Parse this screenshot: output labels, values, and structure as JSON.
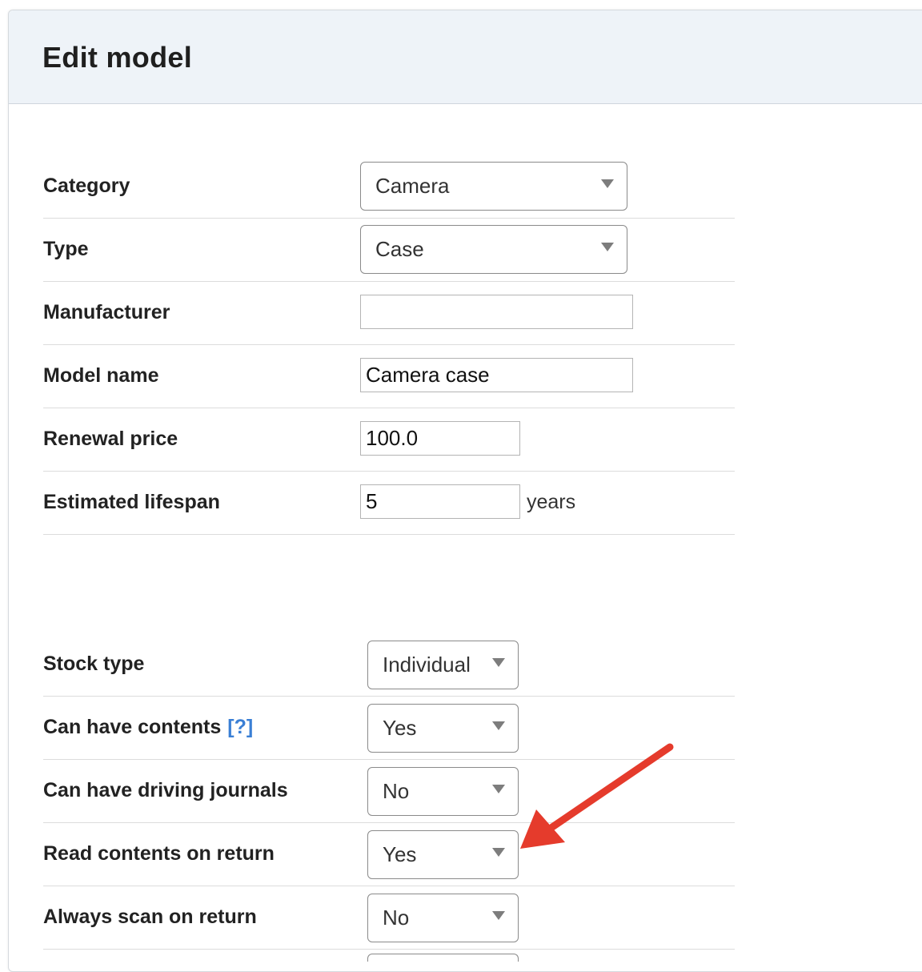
{
  "page": {
    "title": "Edit model"
  },
  "form": {
    "category": {
      "label": "Category",
      "value": "Camera"
    },
    "type": {
      "label": "Type",
      "value": "Case"
    },
    "manufacturer": {
      "label": "Manufacturer",
      "value": ""
    },
    "model_name": {
      "label": "Model name",
      "value": "Camera case"
    },
    "renewal_price": {
      "label": "Renewal price",
      "value": "100.0"
    },
    "estimated_lifespan": {
      "label": "Estimated lifespan",
      "value": "5",
      "unit": "years"
    },
    "stock_type": {
      "label": "Stock type",
      "value": "Individual"
    },
    "can_have_contents": {
      "label": "Can have contents",
      "help": "[?]",
      "value": "Yes"
    },
    "can_have_driving_journals": {
      "label": "Can have driving journals",
      "value": "No"
    },
    "read_contents_on_return": {
      "label": "Read contents on return",
      "value": "Yes"
    },
    "always_scan_on_return": {
      "label": "Always scan on return",
      "value": "No"
    }
  },
  "colors": {
    "header_background": "#eef3f8",
    "help_link": "#3a7fd5",
    "annotation_arrow": "#e53b2c"
  }
}
